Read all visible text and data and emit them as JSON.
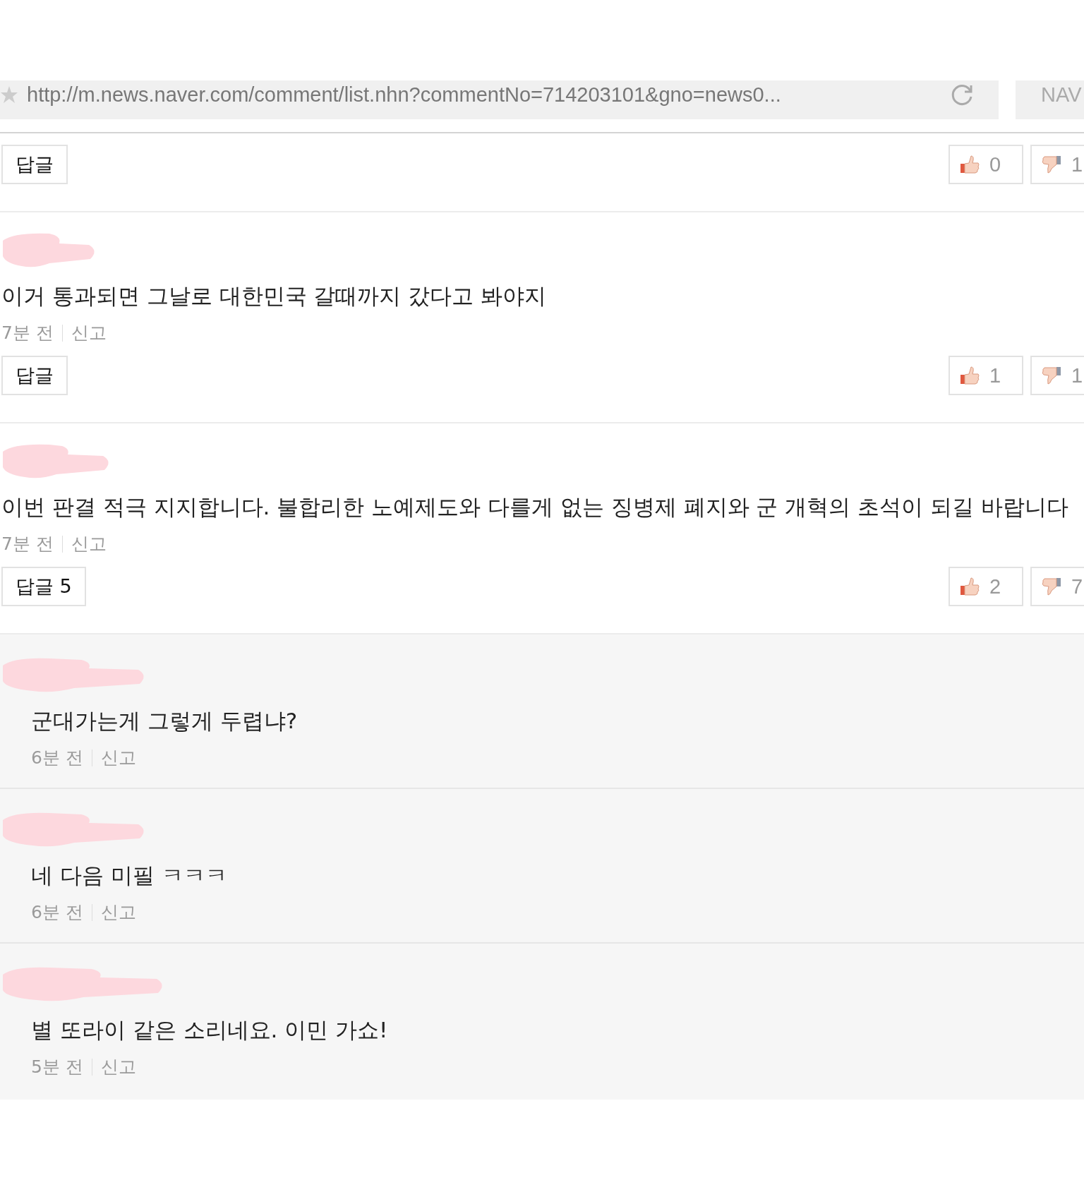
{
  "address_bar": {
    "url": "http://m.news.naver.com/comment/list.nhn?commentNo=714203101&gno=news0...",
    "side_text": "NAV"
  },
  "top_actions": {
    "reply_label": "답글",
    "likes": "0",
    "dislikes": "1"
  },
  "comments": [
    {
      "text": "이거 통과되면 그날로 대한민국 갈때까지 갔다고 봐야지",
      "time": "7분 전",
      "report": "신고",
      "reply_label": "답글",
      "likes": "1",
      "dislikes": "1"
    },
    {
      "text": "이번 판결 적극 지지합니다. 불합리한 노예제도와 다를게 없는 징병제 폐지와 군 개혁의 초석이 되길 바랍니다",
      "time": "7분 전",
      "report": "신고",
      "reply_label": "답글 5",
      "likes": "2",
      "dislikes": "7"
    }
  ],
  "replies": [
    {
      "text": "군대가는게 그렇게 두렵냐?",
      "time": "6분 전",
      "report": "신고"
    },
    {
      "text": "네 다음 미필 ㅋㅋㅋ",
      "time": "6분 전",
      "report": "신고"
    },
    {
      "text": "별 또라이 같은 소리네요. 이민 가쇼!",
      "time": "5분 전",
      "report": "신고"
    }
  ]
}
